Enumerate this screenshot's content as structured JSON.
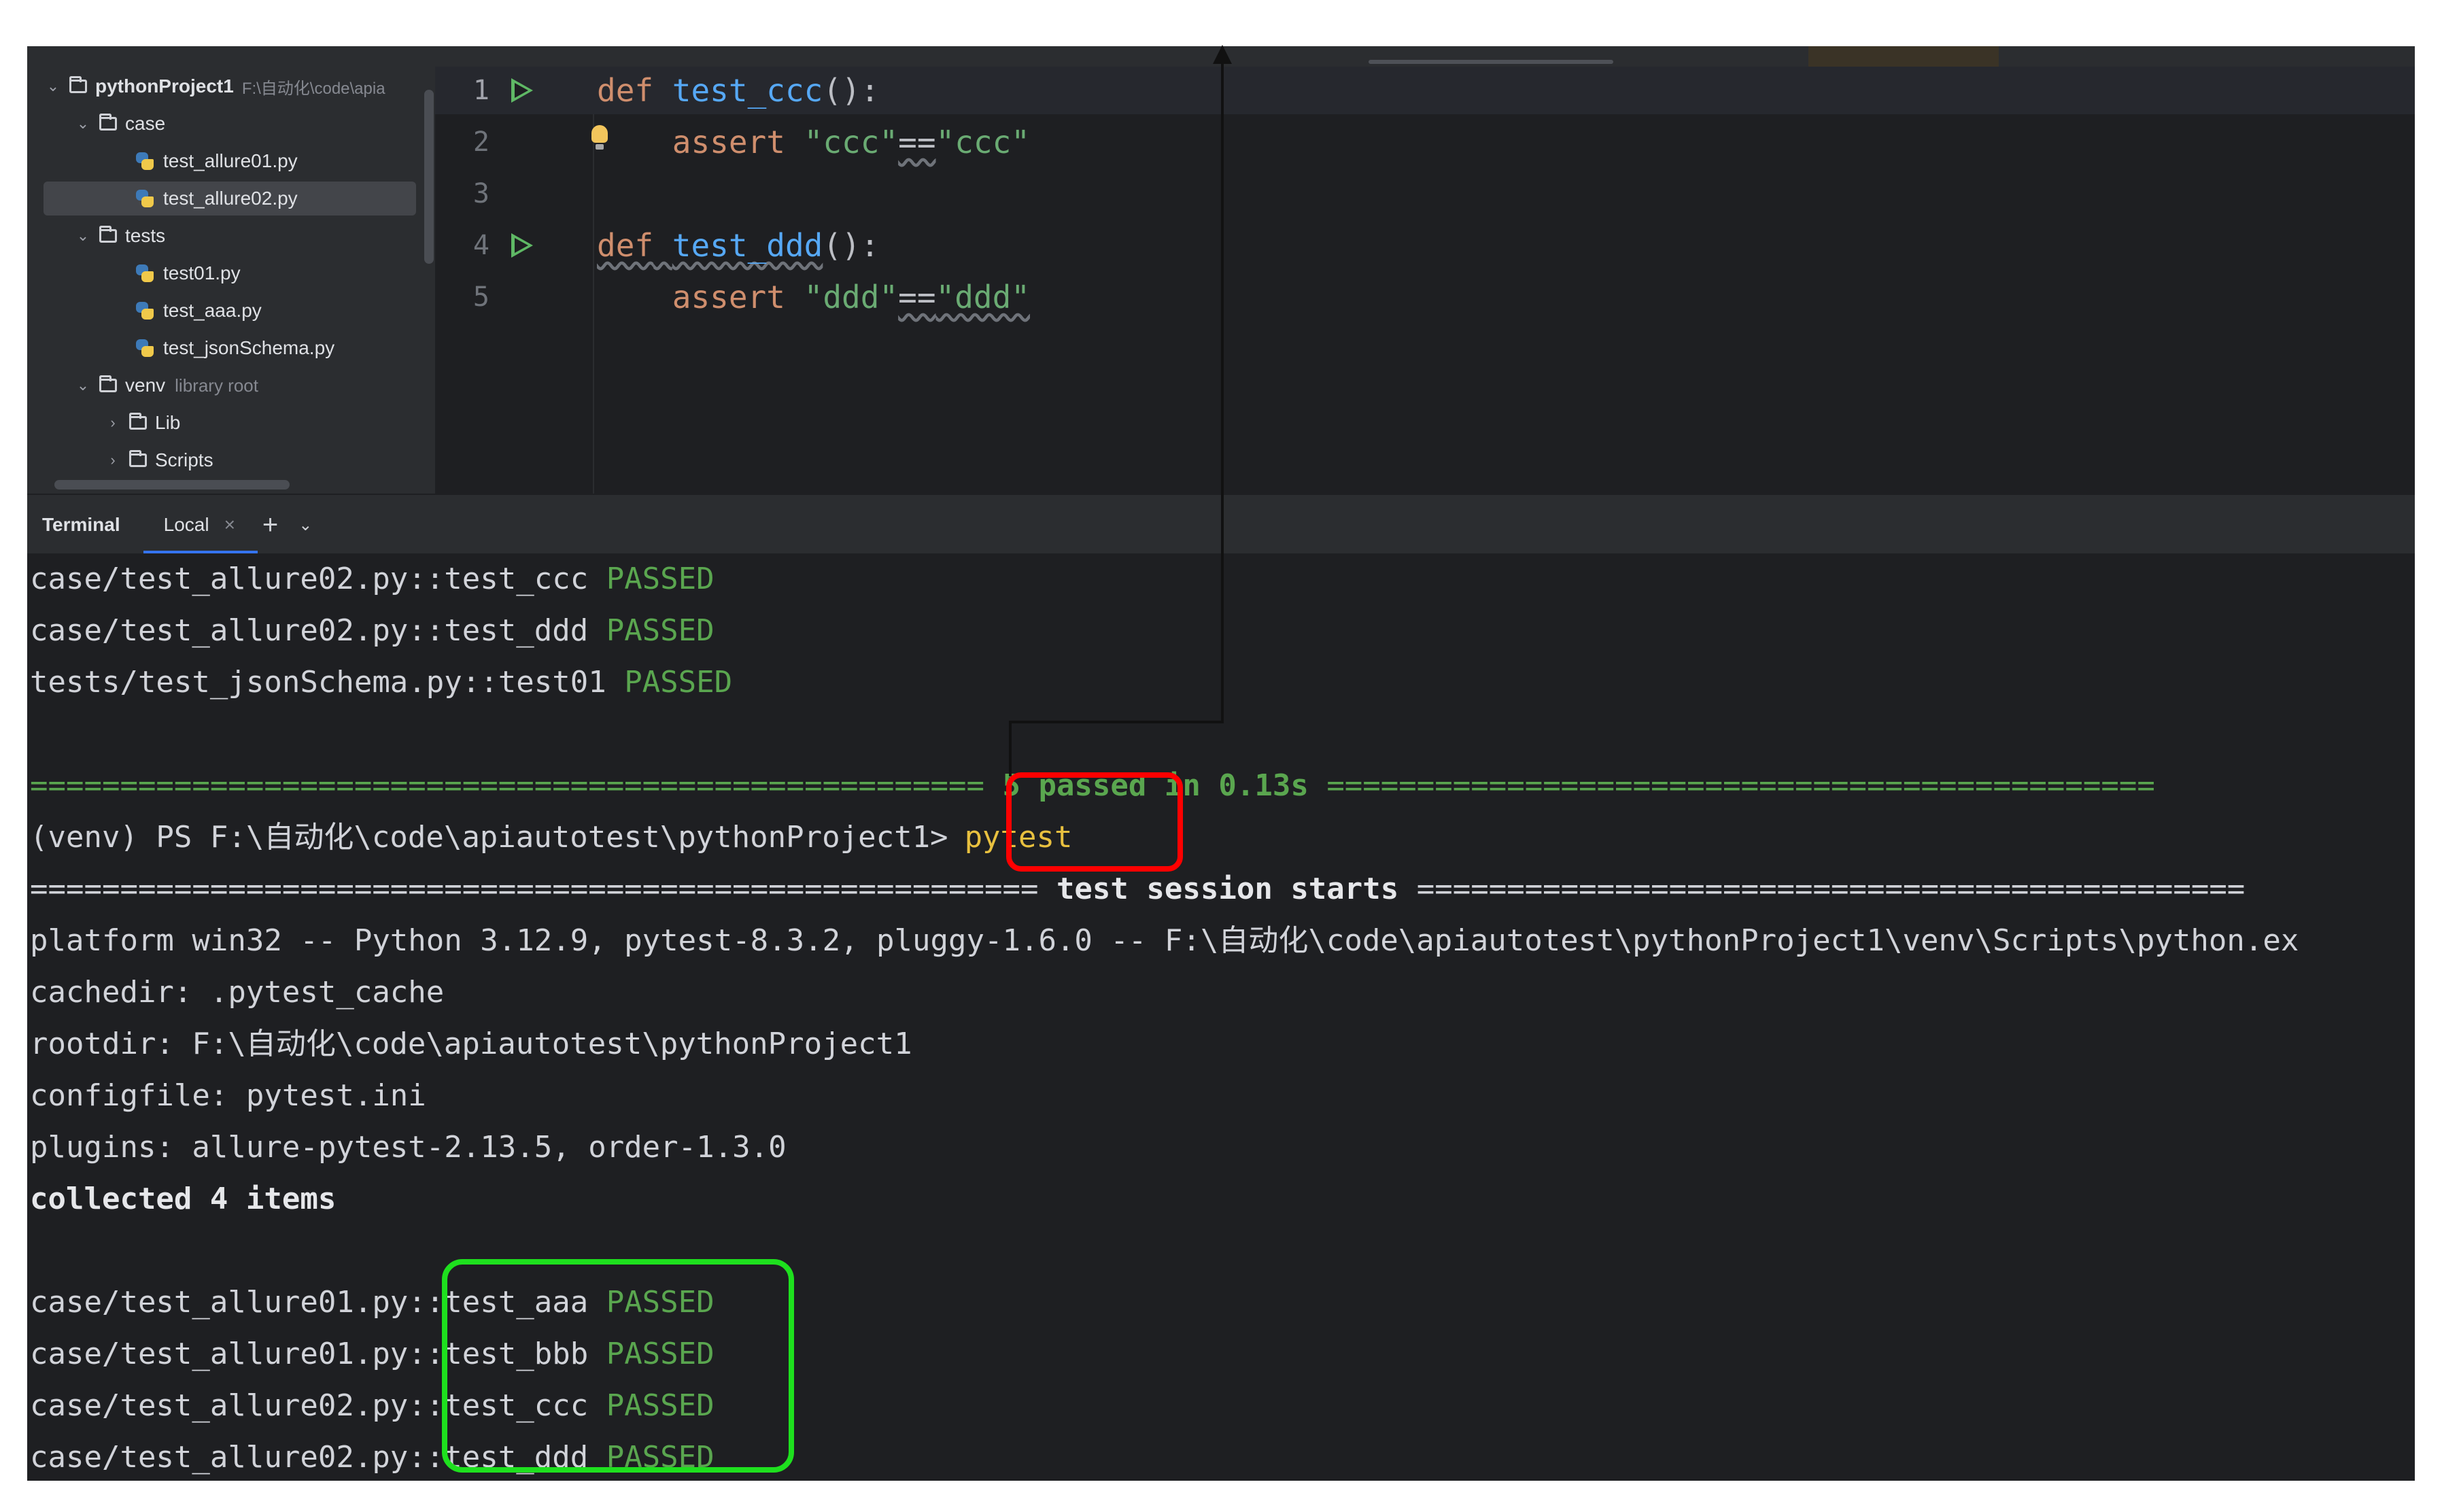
{
  "project_tree": {
    "root_name": "pythonProject1",
    "root_path": "F:\\自动化\\code\\apia",
    "items": [
      {
        "name": "case",
        "type": "folder"
      },
      {
        "name": "test_allure01.py",
        "type": "file"
      },
      {
        "name": "test_allure02.py",
        "type": "file",
        "selected": true
      },
      {
        "name": "tests",
        "type": "folder"
      },
      {
        "name": "test01.py",
        "type": "file"
      },
      {
        "name": "test_aaa.py",
        "type": "file"
      },
      {
        "name": "test_jsonSchema.py",
        "type": "file"
      },
      {
        "name": "venv",
        "type": "folder",
        "note": "library root"
      },
      {
        "name": "Lib",
        "type": "folder"
      },
      {
        "name": "Scripts",
        "type": "folder"
      }
    ]
  },
  "editor": {
    "lines": [
      {
        "num": "1",
        "kw": "def",
        "fn": "test_ccc",
        "rest": "():"
      },
      {
        "num": "2",
        "kw": "assert",
        "s1": "\"ccc\"",
        "op": "==",
        "s2": "\"ccc\""
      },
      {
        "num": "3"
      },
      {
        "num": "4",
        "kw": "def",
        "fn": "test_ddd",
        "rest": "():"
      },
      {
        "num": "5",
        "kw": "assert",
        "s1": "\"ddd\"",
        "op": "==",
        "s2": "\"ddd\""
      }
    ]
  },
  "terminal_header": {
    "title": "Terminal",
    "tab": "Local",
    "close": "×",
    "add": "+",
    "dropdown": "⌄"
  },
  "terminal": {
    "prev_lines": [
      {
        "path": "case/test_allure02.py::test_ccc",
        "status": "PASSED"
      },
      {
        "path": "case/test_allure02.py::test_ddd",
        "status": "PASSED"
      },
      {
        "path": "tests/test_jsonSchema.py::test01",
        "status": "PASSED"
      }
    ],
    "summary_left": "=====================================================",
    "summary_text": " 5 passed in 0.13s ",
    "summary_right": "==============================================",
    "prompt": "(venv) PS F:\\自动化\\code\\apiautotest\\pythonProject1>",
    "command": "pytest",
    "session_left": "========================================================",
    "session_text": " test session starts ",
    "session_right": "==============================================",
    "platform": "platform win32 -- Python 3.12.9, pytest-8.3.2, pluggy-1.6.0 -- F:\\自动化\\code\\apiautotest\\pythonProject1\\venv\\Scripts\\python.ex",
    "cachedir": "cachedir: .pytest_cache",
    "rootdir": "rootdir: F:\\自动化\\code\\apiautotest\\pythonProject1",
    "configfile": "configfile: pytest.ini",
    "plugins": "plugins: allure-pytest-2.13.5, order-1.3.0",
    "collected": "collected 4 items",
    "result_lines": [
      {
        "path": "case/test_allure01.py::test_aaa",
        "status": "PASSED"
      },
      {
        "path": "case/test_allure01.py::test_bbb",
        "status": "PASSED"
      },
      {
        "path": "case/test_allure02.py::test_ccc",
        "status": "PASSED"
      },
      {
        "path": "case/test_allure02.py::test_ddd",
        "status": "PASSED"
      }
    ]
  },
  "icons": [
    "chevron-down-icon",
    "chevron-right-icon",
    "folder-icon",
    "python-file-icon",
    "run-icon",
    "lightbulb-icon",
    "close-icon",
    "plus-icon"
  ],
  "colors": {
    "passed": "#5aa64f",
    "command": "#e8c03f",
    "annotation_red": "#ff0000",
    "annotation_green": "#1ee01e",
    "keyword": "#cf8e6d",
    "function": "#56a8f5",
    "string": "#6aab73"
  }
}
